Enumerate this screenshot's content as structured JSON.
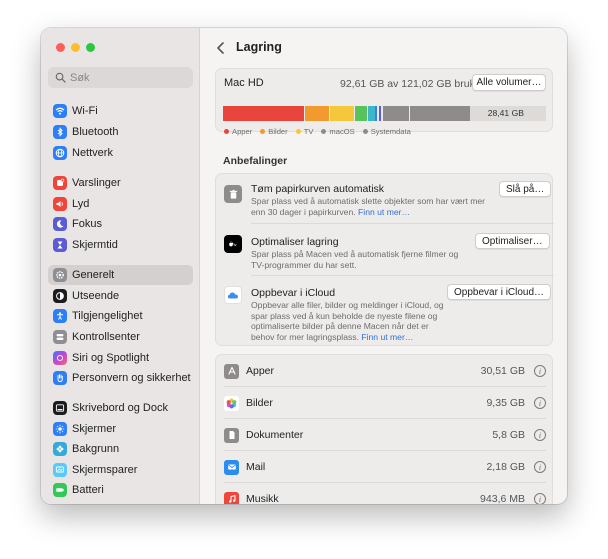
{
  "sidebar": {
    "search_placeholder": "Søk",
    "items": [
      {
        "label": "Wi-Fi",
        "icon": "wifi-icon",
        "color": "#2d7ff9"
      },
      {
        "label": "Bluetooth",
        "icon": "bluetooth-icon",
        "color": "#2d7ff9"
      },
      {
        "label": "Nettverk",
        "icon": "globe-icon",
        "color": "#2d7ff9"
      },
      {
        "label": "Varslinger",
        "icon": "bell-icon",
        "color": "#f0453a"
      },
      {
        "label": "Lyd",
        "icon": "speaker-icon",
        "color": "#f0453a"
      },
      {
        "label": "Fokus",
        "icon": "moon-icon",
        "color": "#5b5bd6"
      },
      {
        "label": "Skjermtid",
        "icon": "hourglass-icon",
        "color": "#5b5bd6"
      },
      {
        "label": "Generelt",
        "icon": "gear-icon",
        "color": "#8e8e93"
      },
      {
        "label": "Utseende",
        "icon": "appearance-icon",
        "color": "#1c1c1e"
      },
      {
        "label": "Tilgjengelighet",
        "icon": "accessibility-icon",
        "color": "#2d7ff9"
      },
      {
        "label": "Kontrollsenter",
        "icon": "control-center-icon",
        "color": "#8e8e93"
      },
      {
        "label": "Siri og Spotlight",
        "icon": "siri-icon",
        "color": "#8e44ad"
      },
      {
        "label": "Personvern og sikkerhet",
        "icon": "hand-icon",
        "color": "#2d7ff9"
      },
      {
        "label": "Skrivebord og Dock",
        "icon": "dock-icon",
        "color": "#1c1c1e"
      },
      {
        "label": "Skjermer",
        "icon": "sun-icon",
        "color": "#2d7ff9"
      },
      {
        "label": "Bakgrunn",
        "icon": "flower-icon",
        "color": "#34aadc"
      },
      {
        "label": "Skjermsparer",
        "icon": "screensaver-icon",
        "color": "#5ac8fa"
      },
      {
        "label": "Batteri",
        "icon": "battery-icon",
        "color": "#34c759"
      }
    ],
    "selected": "Generelt"
  },
  "header": {
    "title": "Lagring"
  },
  "disk": {
    "name": "Mac HD",
    "usage": "92,61 GB av 121,02 GB brukt",
    "button": "Alle volumer…",
    "free_label": "28,41 GB",
    "segments": [
      {
        "label": "Apper",
        "color": "#e8453c",
        "fraction": 0.28
      },
      {
        "label": "Bilder",
        "color": "#f09a30",
        "fraction": 0.08
      },
      {
        "label": "TV",
        "color": "#f5c73a",
        "fraction": 0.08
      },
      {
        "label": "macOS",
        "color": "#8e8b8a",
        "fraction": 0.19
      },
      {
        "label": "Systemdata",
        "color": "#8e8b8a",
        "fraction": 0.19
      }
    ],
    "legend": [
      "Apper",
      "Bilder",
      "TV",
      "macOS",
      "Systemdata"
    ],
    "legend_colors": [
      "#e8453c",
      "#f09a30",
      "#f5c73a",
      "#8e8b8a",
      "#8e8b8a"
    ]
  },
  "recommendations": {
    "heading": "Anbefalinger",
    "items": [
      {
        "title": "Tøm papirkurven automatisk",
        "desc": "Spar plass ved å automatisk slette objekter som har vært mer enn 30 dager i papirkurven.",
        "link": "Finn ut mer…",
        "button": "Slå på…",
        "icon": "trash-icon"
      },
      {
        "title": "Optimaliser lagring",
        "desc": "Spar plass på Macen ved å automatisk fjerne filmer og TV-programmer du har sett.",
        "link": "",
        "button": "Optimaliser…",
        "icon": "appletv-icon"
      },
      {
        "title": "Oppbevar i iCloud",
        "desc": "Oppbevar alle filer, bilder og meldinger i iCloud, og spar plass ved å kun beholde de nyeste filene og optimaliserte bilder på denne Macen når det er behov for mer lagringsplass.",
        "link": "Finn ut mer…",
        "button": "Oppbevar i iCloud…",
        "icon": "icloud-icon"
      }
    ]
  },
  "apps": [
    {
      "label": "Apper",
      "size": "30,51 GB",
      "icon": "apps-icon"
    },
    {
      "label": "Bilder",
      "size": "9,35 GB",
      "icon": "photos-icon"
    },
    {
      "label": "Dokumenter",
      "size": "5,8 GB",
      "icon": "document-icon"
    },
    {
      "label": "Mail",
      "size": "2,18 GB",
      "icon": "mail-icon"
    },
    {
      "label": "Musikk",
      "size": "943,6 MB",
      "icon": "music-icon"
    }
  ]
}
